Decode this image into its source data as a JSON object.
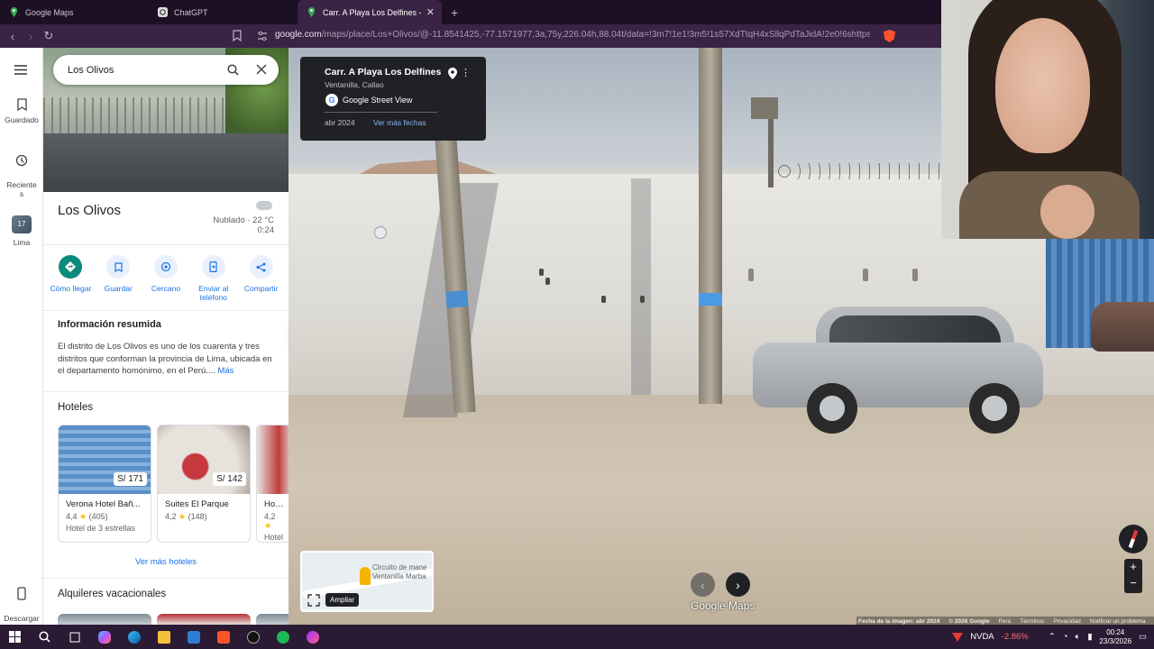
{
  "browser": {
    "tabs": [
      {
        "label": "Google Maps",
        "active": false,
        "icon": "maps-pin-icon"
      },
      {
        "label": "ChatGPT",
        "active": false,
        "icon": "chatgpt-icon"
      },
      {
        "label": "Carr. A Playa Los Delfines - Goog",
        "active": true,
        "icon": "maps-pin-icon"
      }
    ],
    "url_main": "google.com",
    "url_rest": "/maps/place/Los+Olivos/@-11.8541425,-77.1571977,3a,75y,226.04h,88.04t/data=!3m7!1e1!3m5!1s57XdTtqH4xSllqPdTaJidA!2e0!6shttps%3A%2F%2Fst..."
  },
  "rail": {
    "saved": "Guardado",
    "recent": "Reciente\ns",
    "lima": "Lima",
    "lima_badge": "17",
    "download": "Descargar\naplicación"
  },
  "search": {
    "value": "Los Olivos"
  },
  "place": {
    "title": "Los Olivos",
    "weather": "Nublado · 22 °C",
    "time": "0:24"
  },
  "actions": [
    {
      "label": "Cómo llegar",
      "icon": "directions-icon"
    },
    {
      "label": "Guardar",
      "icon": "bookmark-icon"
    },
    {
      "label": "Cercano",
      "icon": "nearby-icon"
    },
    {
      "label": "Enviar al teléfono",
      "icon": "send-to-phone-icon"
    },
    {
      "label": "Compartir",
      "icon": "share-icon"
    }
  ],
  "summary": {
    "title": "Información resumida",
    "text": "El distrito de Los Olivos es uno de los cuarenta y tres distritos que conforman la provincia de Lima, ubicada en el departamento homónimo, en el Perú....",
    "more": "Más"
  },
  "hotels": {
    "title": "Hoteles",
    "items": [
      {
        "name": "Verona Hotel Bañ...",
        "price": "S/ 171",
        "rating": "4,4",
        "reviews": "(405)",
        "type": "Hotel de 3 estrellas"
      },
      {
        "name": "Suites El Parque",
        "price": "S/ 142",
        "rating": "4,2",
        "reviews": "(148)",
        "type": ""
      },
      {
        "name": "Hotel W",
        "price": "",
        "rating": "4,2",
        "reviews": "",
        "type": "Hotel c"
      }
    ],
    "more": "Ver más hoteles"
  },
  "rentals": {
    "title": "Alquileres vacacionales"
  },
  "streetview": {
    "card_title": "Carr. A Playa Los Delfines",
    "card_sub": "Ventanilla, Callao",
    "gsv": "Google Street View",
    "date": "abr 2024",
    "more_dates": "Ver más fechas",
    "minimap_label": "Circuito de mane\nVentanilla Marba",
    "expand_tip": "Ampliar",
    "logo": "Google Maps"
  },
  "footer": {
    "items": [
      "Fecha de la imagen: abr 2024",
      "© 2026 Google",
      "Perú",
      "Términos",
      "Privacidad",
      "Notificar un problema"
    ]
  },
  "taskbar": {
    "stock": "NVDA",
    "change": "-2.86%",
    "time": "00:24",
    "date": "23/3/2026"
  },
  "colors": {
    "accent": "#1a73e8",
    "primary_action": "#0b8b7b",
    "tabbar": "#1d1024",
    "taskbar": "#2b1a33"
  }
}
